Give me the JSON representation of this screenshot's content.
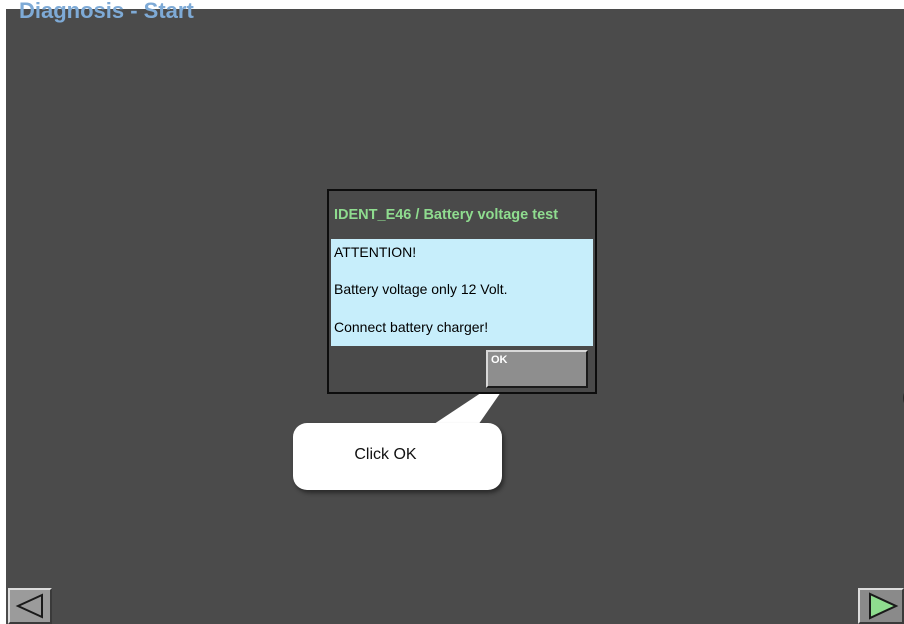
{
  "page": {
    "title": "Diagnosis - Start"
  },
  "dialog": {
    "title": "IDENT_E46 / Battery voltage test",
    "lines": [
      "ATTENTION!",
      "Battery voltage only 12 Volt.",
      "Connect battery charger!"
    ],
    "ok_label": "OK"
  },
  "callout": {
    "text": "Click OK"
  },
  "navigation": {
    "back_icon": "left-triangle-icon",
    "next_icon": "right-triangle-icon",
    "next_color": "#8fdc8f"
  },
  "colors": {
    "screen_background": "#4b4b4b",
    "dialog_title": "#8fdc8f",
    "dialog_body": "#c7eefb",
    "title_blue": "#7eaad6"
  }
}
